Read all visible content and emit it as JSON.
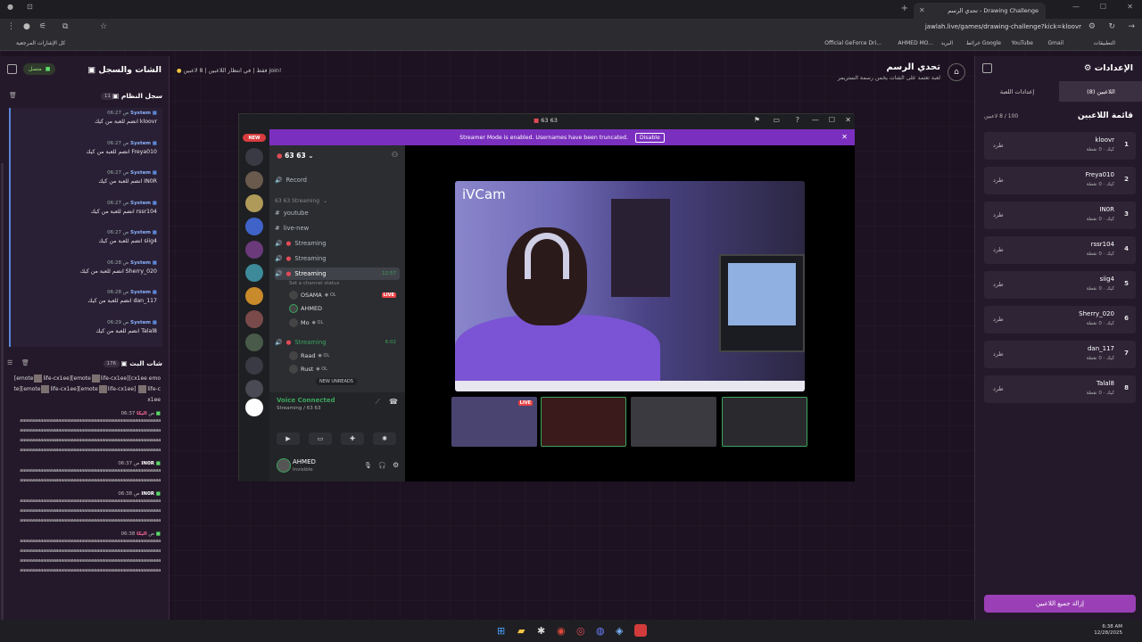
{
  "browser": {
    "tab_title": "تحدي الرسم - Drawing Challenge",
    "url": "jawlah.live/games/drawing-challenge?kick=kloovr",
    "bookmarks": [
      "التطبيقات",
      "Gmail",
      "YouTube",
      "خرائط Google",
      "البريد",
      "AHMED MO...",
      "Official GeForce Dri...",
      "كل الإشارات المرجعية"
    ]
  },
  "chat_panel": {
    "title": "الشات والسجل",
    "status": "متصل",
    "system_log_label": "سجل النظام",
    "system_log_count": "11",
    "system_items": [
      {
        "user": "System",
        "time": "06:27 ص",
        "msg": "kloovr انضم للعبة من كيك"
      },
      {
        "user": "System",
        "time": "06:27 ص",
        "msg": "Freya010 انضم للعبة من كيك"
      },
      {
        "user": "System",
        "time": "06:27 ص",
        "msg": "IN0R انضم للعبة من كيك"
      },
      {
        "user": "System",
        "time": "06:27 ص",
        "msg": "rssr104 انضم للعبة من كيك"
      },
      {
        "user": "System",
        "time": "06:27 ص",
        "msg": "siig4 انضم للعبة من كيك"
      },
      {
        "user": "System",
        "time": "06:28 ص",
        "msg": "Sherry_020 انضم للعبة من كيك"
      },
      {
        "user": "System",
        "time": "06:28 ص",
        "msg": "dan_117 انضم للعبة من كيك"
      },
      {
        "user": "System",
        "time": "06:29 ص",
        "msg": "Talal8 انضم للعبة من كيك"
      }
    ],
    "live_chat_label": "شات البث",
    "live_chat_count": "176",
    "emote_text": [
      "[emote",
      "life-cx1ee][emote",
      "life-cx1ee][cx1ee",
      "emote][emote",
      "life-cx1ee][emote",
      "life-cx1ee]",
      "life-cx1ee"
    ],
    "messages": [
      {
        "user": "اليكا",
        "time": "06:37 ص"
      },
      {
        "user": "IN0R",
        "time": "06:37 ص"
      },
      {
        "user": "IN0R",
        "time": "06:38 ص"
      },
      {
        "user": "اليكا",
        "time": "06:38 ص"
      }
    ],
    "a_line": "aaaaaaaaaaaaaaaaaaaaaaaaaaaaaaaaaaaaaaaaaaaaaaaaaaaaaaa"
  },
  "header": {
    "game_title": "تحدي الرسم",
    "game_subtitle": "لعبة تعتمد على الشات يخمن رسمة الستريمر",
    "players_info": "8 لاعبين",
    "waiting": "في انتظار اللاعبين",
    "join_only": "!join فقط"
  },
  "settings": {
    "title": "الإعدادات",
    "tab_players": "اللاعبين (8)",
    "tab_game": "إعدادات اللعبة",
    "players_title": "قائمة اللاعبين",
    "players_count": "100 / 8 لاعبين",
    "kick_label": "طرد",
    "clear_button": "إزالة جميع اللاعبين",
    "players": [
      {
        "rank": "1",
        "name": "kloovr",
        "pts": "كيك · 0 نقطة"
      },
      {
        "rank": "2",
        "name": "Freya010",
        "pts": "كيك · 0 نقطة"
      },
      {
        "rank": "3",
        "name": "IN0R",
        "pts": "كيك · 0 نقطة"
      },
      {
        "rank": "4",
        "name": "rssr104",
        "pts": "كيك · 0 نقطة"
      },
      {
        "rank": "5",
        "name": "siig4",
        "pts": "كيك · 0 نقطة"
      },
      {
        "rank": "6",
        "name": "Sherry_020",
        "pts": "كيك · 0 نقطة"
      },
      {
        "rank": "7",
        "name": "dan_117",
        "pts": "كيك · 0 نقطة"
      },
      {
        "rank": "8",
        "name": "Talal8",
        "pts": "كيك · 0 نقطة"
      }
    ]
  },
  "discord": {
    "window_title": "63 63",
    "banner_text": "Streamer Mode is enabled. Usernames have been truncated.",
    "banner_button": "Disable",
    "new_badge": "NEW",
    "server_name": "63 63",
    "category": "63 63 Streaming",
    "channels": [
      "Record",
      "youtube",
      "live-new",
      "Streaming",
      "Streaming",
      "Streaming"
    ],
    "selected_channel": "Streaming",
    "selected_time": "12:57",
    "set_status": "Set a channel status",
    "vc_users": [
      "OSAMA",
      "AHMED",
      "Mo"
    ],
    "live_tag": "LIVE",
    "second_streaming": "Streaming",
    "second_time": "6:02",
    "second_users": [
      "Raad",
      "Rust"
    ],
    "new_unreads": "NEW UNREADS",
    "voice_connected": "Voice Connected",
    "voice_sub": "Streaming / 63 63",
    "me_name": "AHMED",
    "me_status": "Invisible",
    "cam_label": "iVCam",
    "thumb_live": "LIVE"
  },
  "taskbar": {
    "time": "6:38 AM",
    "date": "12/28/2025"
  }
}
